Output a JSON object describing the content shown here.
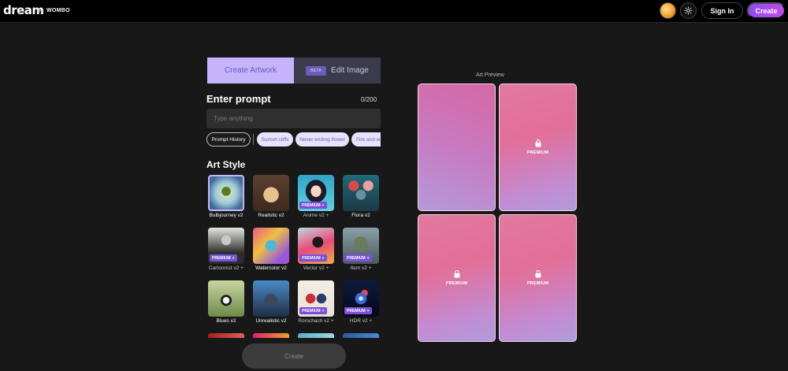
{
  "header": {
    "logo": "dream",
    "by": "by",
    "wombo": "WOMBO",
    "signin_label": "Sign In",
    "create_label": "Create"
  },
  "tabs": {
    "create": "Create Artwork",
    "edit": "Edit Image",
    "beta": "BETA"
  },
  "prompt": {
    "title": "Enter prompt",
    "counter": "0/200",
    "placeholder": "Type anything",
    "history_label": "Prompt History",
    "suggestions": [
      "Sunset cliffs",
      "Never ending flower",
      "Fire and water"
    ]
  },
  "art_style": {
    "title": "Art Style",
    "premium_label": "PREMIUM",
    "styles": [
      {
        "name": "Bulbjourney v2",
        "premium": false
      },
      {
        "name": "Realistic v2",
        "premium": false
      },
      {
        "name": "Anime v2",
        "premium": true
      },
      {
        "name": "Flora v2",
        "premium": false
      },
      {
        "name": "Cartoonist v2",
        "premium": true
      },
      {
        "name": "Watercolor v2",
        "premium": false
      },
      {
        "name": "Vector v2",
        "premium": true
      },
      {
        "name": "Item v2",
        "premium": true
      },
      {
        "name": "Blues v2",
        "premium": false
      },
      {
        "name": "Unrealistic v2",
        "premium": false
      },
      {
        "name": "Rorschach v2",
        "premium": true
      },
      {
        "name": "HDR v2",
        "premium": true
      }
    ]
  },
  "create_button": "Create",
  "preview": {
    "title": "Art Preview",
    "premium_label": "PREMIUM"
  },
  "colors": {
    "accent": "#c5b4fa",
    "create_gradient_start": "#8e4cf5",
    "create_gradient_end": "#c04ce8",
    "premium_tag": "#7a50d8"
  }
}
